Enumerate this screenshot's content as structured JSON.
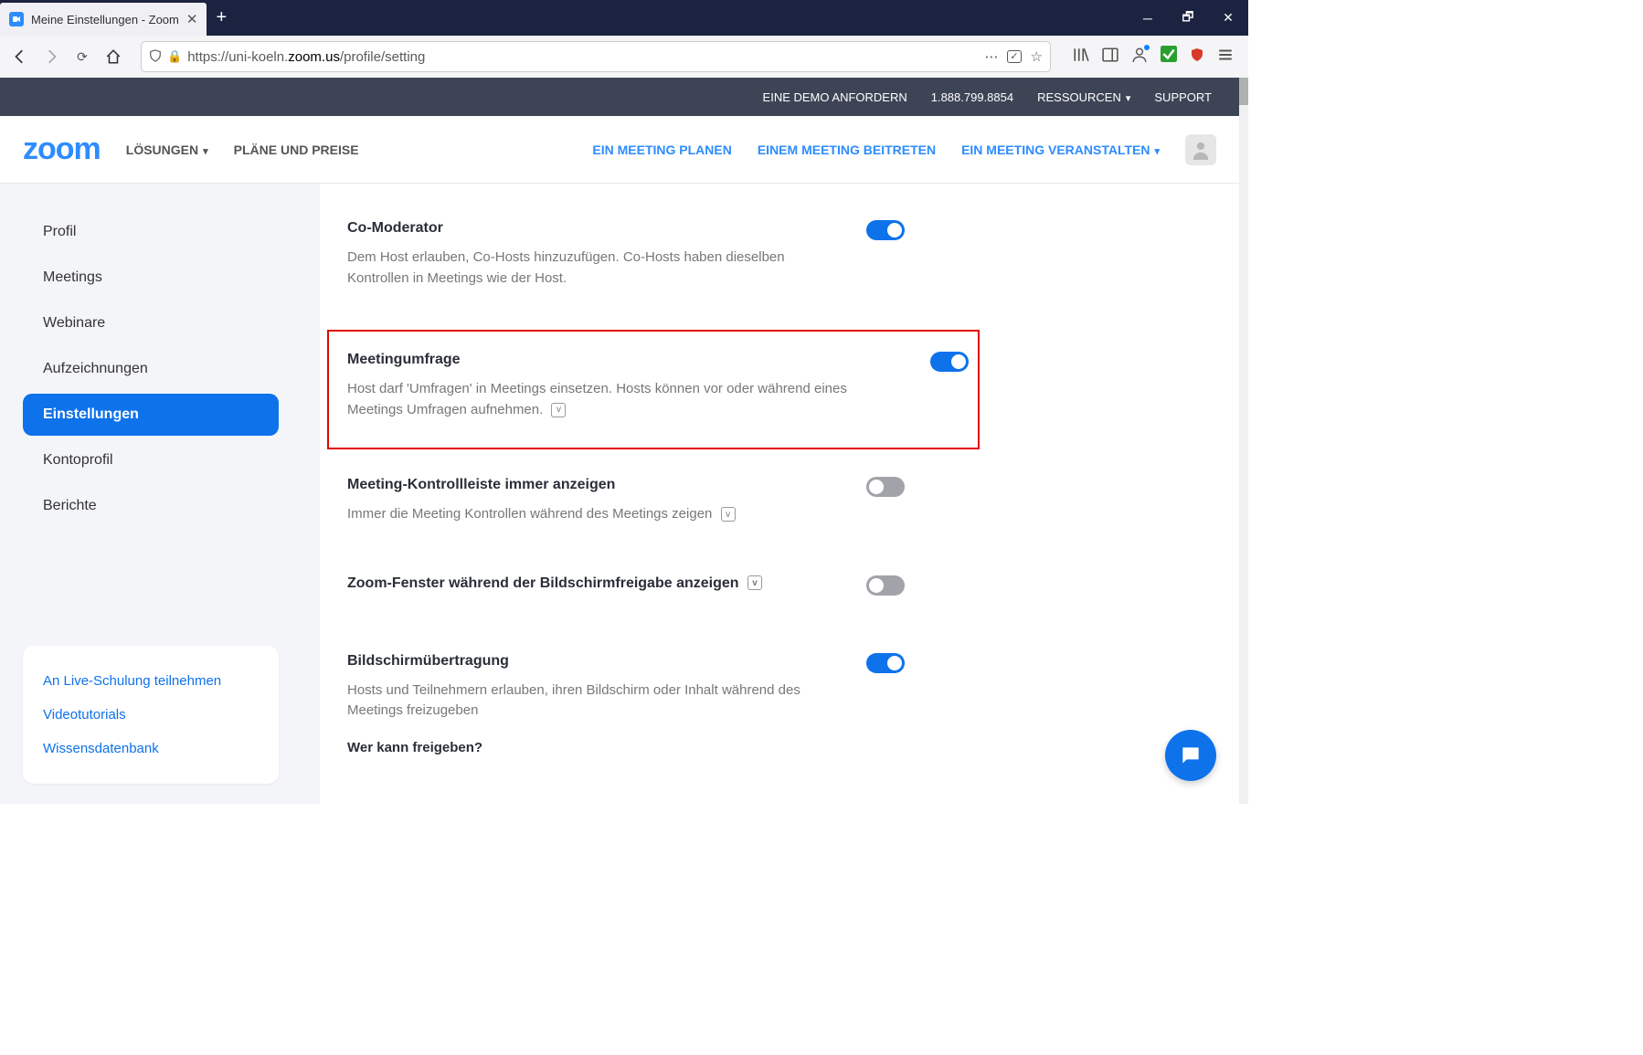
{
  "browser": {
    "tab_title": "Meine Einstellungen - Zoom",
    "url_prefix": "https://uni-koeln.",
    "url_host": "zoom.us",
    "url_path": "/profile/setting"
  },
  "topbar": {
    "demo": "EINE DEMO ANFORDERN",
    "phone": "1.888.799.8854",
    "resources": "RESSOURCEN",
    "support": "SUPPORT"
  },
  "nav": {
    "logo": "zoom",
    "solutions": "LÖSUNGEN",
    "plans": "PLÄNE UND PREISE",
    "schedule": "EIN MEETING PLANEN",
    "join": "EINEM MEETING BEITRETEN",
    "host": "EIN MEETING VERANSTALTEN"
  },
  "sidebar": {
    "items": [
      "Profil",
      "Meetings",
      "Webinare",
      "Aufzeichnungen",
      "Einstellungen",
      "Kontoprofil",
      "Berichte"
    ],
    "secondary": [
      "An Live-Schulung teilnehmen",
      "Videotutorials",
      "Wissensdatenbank"
    ]
  },
  "settings": {
    "co_moderator": {
      "title": "Co-Moderator",
      "desc": "Dem Host erlauben, Co-Hosts hinzuzufügen. Co-Hosts haben dieselben Kontrollen in Meetings wie der Host.",
      "enabled": true
    },
    "polling": {
      "title": "Meetingumfrage",
      "desc": "Host darf 'Umfragen' in Meetings einsetzen. Hosts können vor oder während eines Meetings Umfragen aufnehmen.",
      "enabled": true
    },
    "toolbar": {
      "title": "Meeting-Kontrollleiste immer anzeigen",
      "desc": "Immer die Meeting Kontrollen während des Meetings zeigen",
      "enabled": false
    },
    "show_window": {
      "title": "Zoom-Fenster während der Bildschirmfreigabe anzeigen",
      "enabled": false
    },
    "screen_share": {
      "title": "Bildschirmübertragung",
      "desc": "Hosts und Teilnehmern erlauben, ihren Bildschirm oder Inhalt während des Meetings freizugeben",
      "enabled": true,
      "question": "Wer kann freigeben?"
    }
  }
}
